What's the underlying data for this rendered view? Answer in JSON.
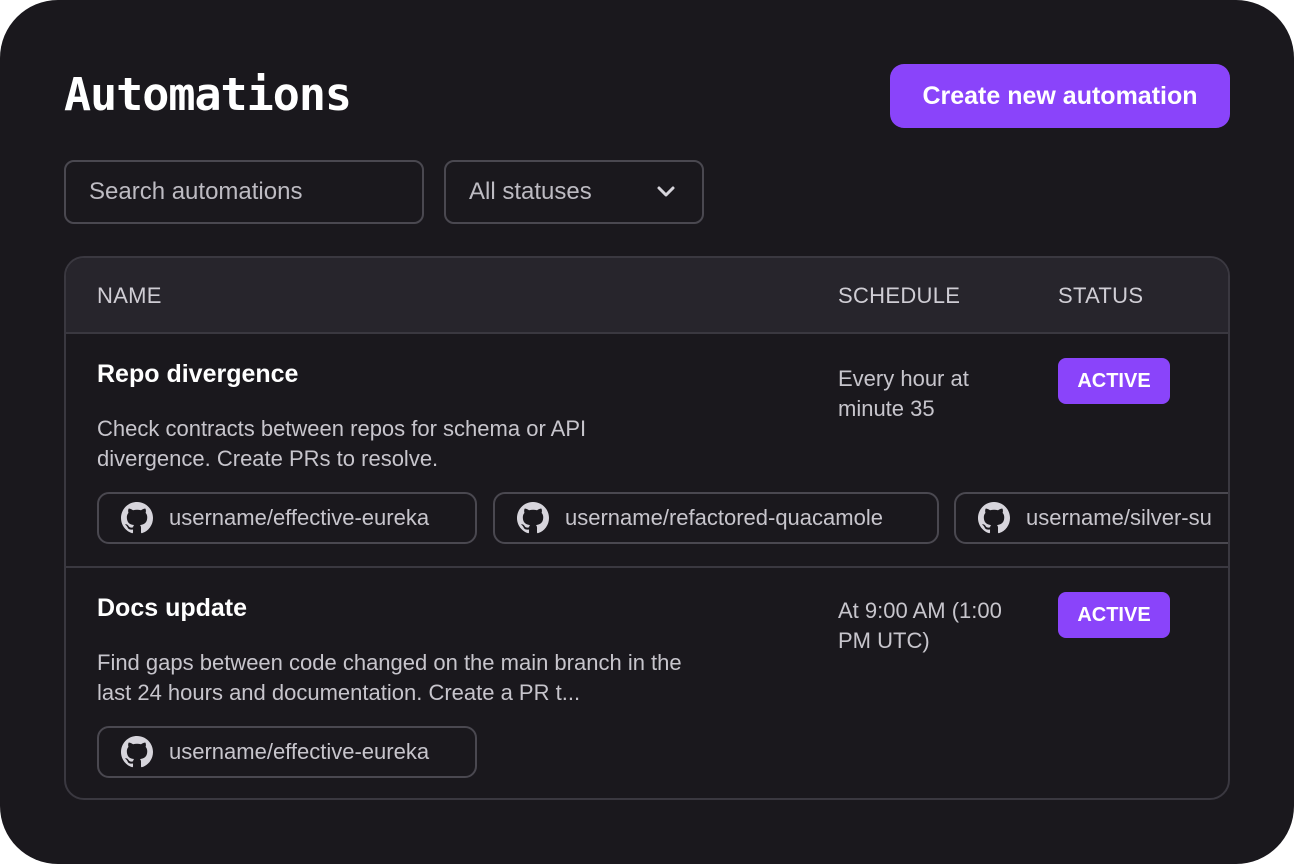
{
  "header": {
    "title": "Automations",
    "create_button_label": "Create new automation"
  },
  "filters": {
    "search_placeholder": "Search automations",
    "status_selected": "All statuses"
  },
  "table": {
    "columns": [
      "NAME",
      "SCHEDULE",
      "STATUS"
    ],
    "rows": [
      {
        "name": "Repo divergence",
        "description": "Check contracts between repos for schema or API divergence. Create PRs to resolve.",
        "schedule": "Every hour at minute 35",
        "status": "ACTIVE",
        "repos": [
          "username/effective-eureka",
          "username/refactored-quacamole",
          "username/silver-su"
        ]
      },
      {
        "name": "Docs update",
        "description": "Find gaps between code changed on the main branch in the last 24 hours and documentation. Create a PR t...",
        "schedule": "At 9:00 AM (1:00 PM UTC)",
        "status": "ACTIVE",
        "repos": [
          "username/effective-eureka"
        ]
      }
    ]
  },
  "icons": {
    "repo_icon": "github-icon",
    "dropdown_icon": "chevron-down-icon"
  },
  "colors": {
    "accent": "#8a44fa",
    "background": "#1a181d",
    "table_header": "#27252c",
    "border": "#3a3840"
  }
}
